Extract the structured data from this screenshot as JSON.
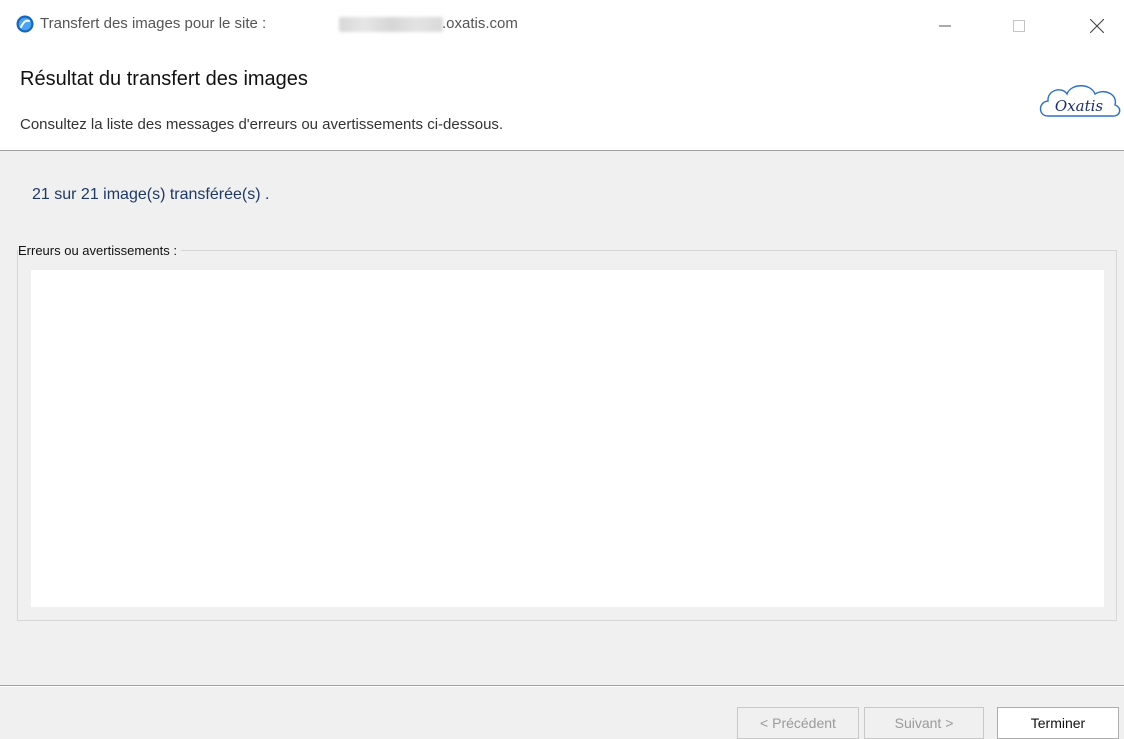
{
  "window": {
    "title_prefix": "Transfert des images pour le site :",
    "title_suffix": ".oxatis.com"
  },
  "header": {
    "title": "Résultat du transfert des images",
    "subtitle": "Consultez la liste des messages d'erreurs ou avertissements ci-dessous.",
    "logo_text": "Oxatis"
  },
  "result": {
    "status": "21 sur 21 image(s) transférée(s) ."
  },
  "messages": {
    "label": "Erreurs ou avertissements :",
    "items": []
  },
  "buttons": {
    "previous": "< Précédent",
    "next": "Suivant >",
    "finish": "Terminer"
  },
  "icons": {
    "app": "oxatis-app-icon",
    "minimize": "minimize-icon",
    "maximize": "maximize-icon",
    "close": "close-icon"
  },
  "colors": {
    "status_text": "#1f3864",
    "logo_blue": "#2a6fc9"
  }
}
